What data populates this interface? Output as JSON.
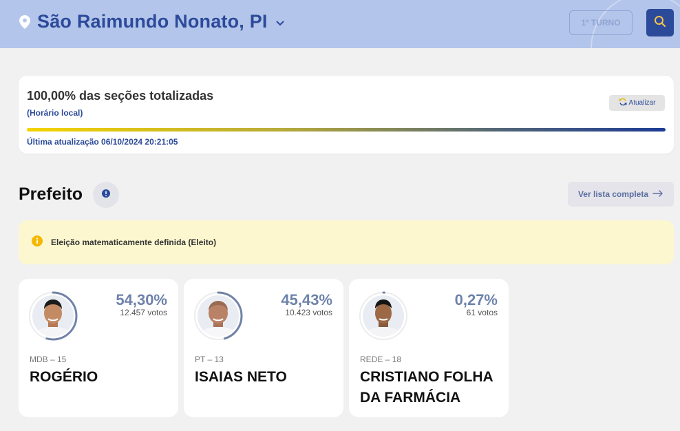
{
  "header": {
    "city": "São Raimundo Nonato, PI",
    "turno_label": "1º TURNO",
    "icons": {
      "location": "map-pin-icon",
      "chevron": "chevron-down-icon",
      "search": "search-icon"
    }
  },
  "status": {
    "title": "100,00% das seções totalizadas",
    "horario": "(Horário local)",
    "atualizar_label": "Atualizar",
    "progress_fraction": 1.0,
    "last_update": "Última atualização 06/10/2024 20:21:05"
  },
  "section": {
    "title": "Prefeito",
    "ver_lista_label": "Ver lista completa"
  },
  "alert": {
    "text": "Eleição matematicamente definida (Eleito)"
  },
  "candidates": [
    {
      "pct": "54,30%",
      "pct_value": 0.543,
      "votos": "12.457 votos",
      "partido": "MDB – 15",
      "nome": "ROGÉRIO"
    },
    {
      "pct": "45,43%",
      "pct_value": 0.4543,
      "votos": "10.423 votos",
      "partido": "PT – 13",
      "nome": "ISAIAS NETO"
    },
    {
      "pct": "0,27%",
      "pct_value": 0.0027,
      "votos": "61 votos",
      "partido": "REDE – 18",
      "nome": "CRISTIANO FOLHA DA FARMÁCIA"
    }
  ],
  "colors": {
    "brand_blue": "#2c4a9a",
    "topbar": "#b3c5ea",
    "ring": "#7082a8",
    "alert_bg": "#fcf7cf",
    "alert_icon": "#f5b800"
  }
}
